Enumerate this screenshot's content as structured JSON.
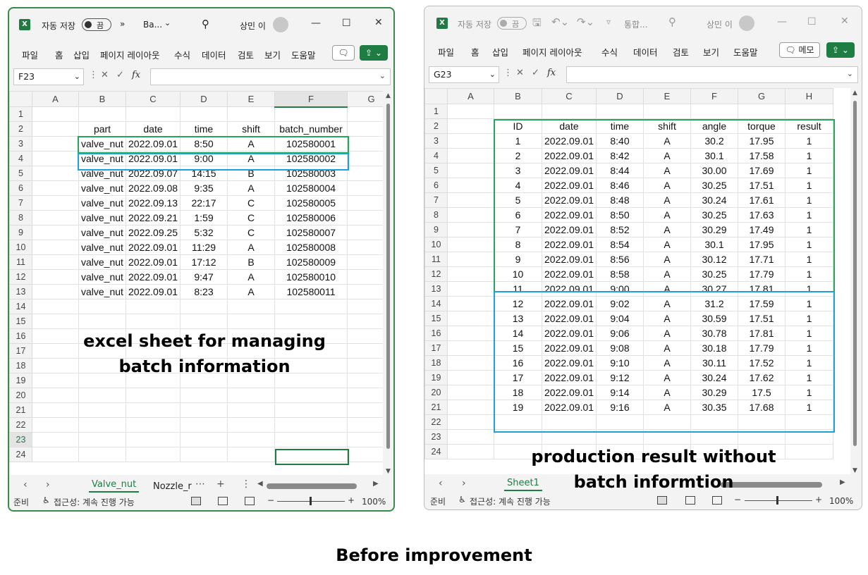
{
  "caption": "Before improvement",
  "window1": {
    "app_icon": "excel-icon",
    "autosave_label": "자동 저장",
    "autosave_state": "끔",
    "more": "»",
    "filename": "Ba...",
    "user": "상민 이",
    "menu": [
      "파일",
      "홈",
      "삽입",
      "페이지 레이아웃",
      "수식",
      "데이터",
      "검토",
      "보기",
      "도움말"
    ],
    "name_box": "F23",
    "columns": [
      "A",
      "B",
      "C",
      "D",
      "E",
      "F",
      "G"
    ],
    "rows": [
      "1",
      "2",
      "3",
      "4",
      "5",
      "6",
      "7",
      "8",
      "9",
      "10",
      "11",
      "12",
      "13",
      "14",
      "15",
      "16",
      "17",
      "18",
      "19",
      "20",
      "21",
      "22",
      "23",
      "24"
    ],
    "header": [
      "part",
      "date",
      "time",
      "shift",
      "batch_number"
    ],
    "data": [
      [
        "valve_nut",
        "2022.09.01",
        "8:50",
        "A",
        "102580001"
      ],
      [
        "valve_nut",
        "2022.09.01",
        "9:00",
        "A",
        "102580002"
      ],
      [
        "valve_nut",
        "2022.09.07",
        "14:15",
        "B",
        "102580003"
      ],
      [
        "valve_nut",
        "2022.09.08",
        "9:35",
        "A",
        "102580004"
      ],
      [
        "valve_nut",
        "2022.09.13",
        "22:17",
        "C",
        "102580005"
      ],
      [
        "valve_nut",
        "2022.09.21",
        "1:59",
        "C",
        "102580006"
      ],
      [
        "valve_nut",
        "2022.09.25",
        "5:32",
        "C",
        "102580007"
      ],
      [
        "valve_nut",
        "2022.09.01",
        "11:29",
        "A",
        "102580008"
      ],
      [
        "valve_nut",
        "2022.09.01",
        "17:12",
        "B",
        "102580009"
      ],
      [
        "valve_nut",
        "2022.09.01",
        "9:47",
        "A",
        "102580010"
      ],
      [
        "valve_nut",
        "2022.09.01",
        "8:23",
        "A",
        "102580011"
      ]
    ],
    "tabs": [
      "Valve_nut",
      "Nozzle_r"
    ],
    "overlay_text": [
      "excel sheet for managing",
      "batch information"
    ],
    "status_ready": "준비",
    "status_accessibility": "접근성: 계속 진행 가능",
    "zoom": "100%"
  },
  "window2": {
    "app_icon": "excel-icon",
    "autosave_label": "자동 저장",
    "autosave_state": "끔",
    "filename": "통합...",
    "user": "상민 이",
    "menu": [
      "파일",
      "홈",
      "삽입",
      "페이지 레이아웃",
      "수식",
      "데이터",
      "검토",
      "보기",
      "도움말"
    ],
    "memo_label": "메모",
    "name_box": "G23",
    "columns": [
      "A",
      "B",
      "C",
      "D",
      "E",
      "F",
      "G",
      "H"
    ],
    "rows": [
      "1",
      "2",
      "3",
      "4",
      "5",
      "6",
      "7",
      "8",
      "9",
      "10",
      "11",
      "12",
      "13",
      "14",
      "15",
      "16",
      "17",
      "18",
      "19",
      "20",
      "21",
      "22",
      "23",
      "24"
    ],
    "header": [
      "ID",
      "date",
      "time",
      "shift",
      "angle",
      "torque",
      "result"
    ],
    "data": [
      [
        "1",
        "2022.09.01",
        "8:40",
        "A",
        "30.2",
        "17.95",
        "1"
      ],
      [
        "2",
        "2022.09.01",
        "8:42",
        "A",
        "30.1",
        "17.58",
        "1"
      ],
      [
        "3",
        "2022.09.01",
        "8:44",
        "A",
        "30.00",
        "17.69",
        "1"
      ],
      [
        "4",
        "2022.09.01",
        "8:46",
        "A",
        "30.25",
        "17.51",
        "1"
      ],
      [
        "5",
        "2022.09.01",
        "8:48",
        "A",
        "30.24",
        "17.61",
        "1"
      ],
      [
        "6",
        "2022.09.01",
        "8:50",
        "A",
        "30.25",
        "17.63",
        "1"
      ],
      [
        "7",
        "2022.09.01",
        "8:52",
        "A",
        "30.29",
        "17.49",
        "1"
      ],
      [
        "8",
        "2022.09.01",
        "8:54",
        "A",
        "30.1",
        "17.95",
        "1"
      ],
      [
        "9",
        "2022.09.01",
        "8:56",
        "A",
        "30.12",
        "17.71",
        "1"
      ],
      [
        "10",
        "2022.09.01",
        "8:58",
        "A",
        "30.25",
        "17.79",
        "1"
      ],
      [
        "11",
        "2022.09.01",
        "9:00",
        "A",
        "30.27",
        "17.81",
        "1"
      ],
      [
        "12",
        "2022.09.01",
        "9:02",
        "A",
        "31.2",
        "17.59",
        "1"
      ],
      [
        "13",
        "2022.09.01",
        "9:04",
        "A",
        "30.59",
        "17.51",
        "1"
      ],
      [
        "14",
        "2022.09.01",
        "9:06",
        "A",
        "30.78",
        "17.81",
        "1"
      ],
      [
        "15",
        "2022.09.01",
        "9:08",
        "A",
        "30.18",
        "17.79",
        "1"
      ],
      [
        "16",
        "2022.09.01",
        "9:10",
        "A",
        "30.11",
        "17.52",
        "1"
      ],
      [
        "17",
        "2022.09.01",
        "9:12",
        "A",
        "30.24",
        "17.62",
        "1"
      ],
      [
        "18",
        "2022.09.01",
        "9:14",
        "A",
        "30.29",
        "17.5",
        "1"
      ],
      [
        "19",
        "2022.09.01",
        "9:16",
        "A",
        "30.35",
        "17.68",
        "1"
      ]
    ],
    "tabs": [
      "Sheet1"
    ],
    "overlay_text": [
      "production result without",
      "batch informtion"
    ],
    "status_ready": "준비",
    "status_accessibility": "접근성: 계속 진행 가능",
    "zoom": "100%"
  },
  "colors": {
    "excel_green": "#1e7d42",
    "highlight_green": "#26a65b",
    "highlight_blue": "#1ea0d8"
  }
}
